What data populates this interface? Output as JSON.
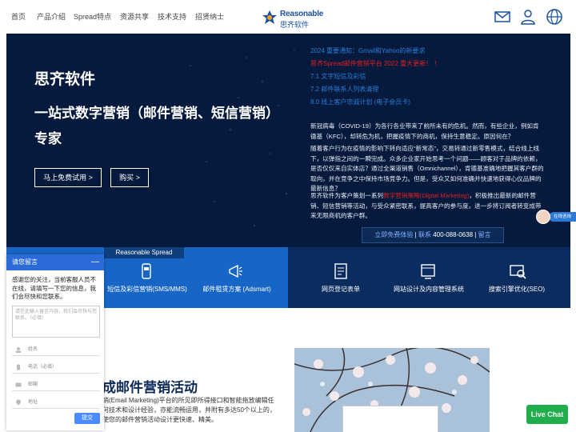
{
  "nav": {
    "items": [
      {
        "label": "首页"
      },
      {
        "label": "产品介绍"
      },
      {
        "label": "Spread特点"
      },
      {
        "label": "资源共享"
      },
      {
        "label": "技术支持"
      },
      {
        "label": "招贤纳士"
      }
    ],
    "logo_en": "Reasonable",
    "logo_cn": "思齐软件"
  },
  "hero": {
    "brand": "思齐软件",
    "title": "一站式数字营销（邮件营销、短信营销）专家",
    "btn_trial": "马上免费试用 >",
    "btn_buy": "购买 >"
  },
  "news": [
    {
      "text": "2024 重要通知：Gmail和Yahoo的新要求"
    },
    {
      "text": "思齐Spread邮件营销平台 2022 重大更新！ ！"
    },
    {
      "text": "7.1 文字短信及彩信"
    },
    {
      "text": "7.2 邮件联系人列表清理"
    },
    {
      "text": "8.0 线上客户忠诚计划 (电子会员卡)"
    }
  ],
  "paragraphs": {
    "p1": "新冠病毒（COVID-19）为各行各业带来了前所未有的危机。然而，有些企业，例如肯德基（KFC），却转危为机，把握疫情下的商机，保持生意稳定。原因何在？",
    "p2": "随着客户行为在疫情的影响下转向适应“新常态”，交易转通过新零售模式，结合线上线下，以弹指之间的一瞬完成。众多企业家开始思考一个问题——顾客对于品牌的依赖，是否仅仅来自实体店？通过全渠道销售（Omnichannel），肯德基准确地把握其客户群的取向，并在竞争之中保持市场竞争力。但是，受众又如何准确并快速地获得心仪品牌的最新信息？",
    "p3_a": "思齐软件为客户策划一系列",
    "p3_hl": "数字营销策略(Digital Marketing)",
    "p3_b": "，积极推出最新的邮件营销、短信营销等活动，与受众紧密联系，提高客户的参与度，进一步将订阅者转变成带来无限商机的客户群。"
  },
  "cta": {
    "trial": "立即免费体验",
    "sep1": "|",
    "contact": "联系",
    "phone": "400-088-0638",
    "sep2": "|",
    "msg": "留言"
  },
  "services": {
    "label": "Reasonable Spread",
    "items": [
      {
        "label": "短信及彩信营销(SMS/MMS)"
      },
      {
        "label": "邮件租赁方案 (Adsmart)"
      },
      {
        "label": "网页登记表单"
      },
      {
        "label": "网站设计及内容管理系统"
      },
      {
        "label": "搜索引擎优化(SEO)"
      }
    ]
  },
  "bottom": {
    "title": "成邮件营销活动",
    "text": "销(Email Marketing)平台的所见即所得接口和智能拖放编辑任何技术和设计经验，亦能流畅运用，并附有多达50个以上的，使您的邮件营销活动设计更快速、精美。"
  },
  "chat": {
    "title": "请您留言",
    "minimize": "—",
    "message": "感谢您的关注，当前客服人员不在线，请填写一下您的信息，我们会尽快和您联系。",
    "textarea_placeholder": "请在此输入留言内容，我们会尽快与您联系。（必填）",
    "fields": [
      {
        "placeholder": "姓名"
      },
      {
        "placeholder": "电话（必填）"
      },
      {
        "placeholder": "邮箱"
      },
      {
        "placeholder": "地址"
      }
    ],
    "submit": "提交"
  },
  "online_service": "在线咨询",
  "live_chat": "Live Chat",
  "colors": {
    "hero_bg": "#061a3d",
    "accent_blue": "#2b7bd6",
    "highlight_red": "#e02020",
    "service_left": "#1766c6",
    "service_right": "#0b2c5e",
    "live_chat_green": "#1fae4b"
  }
}
